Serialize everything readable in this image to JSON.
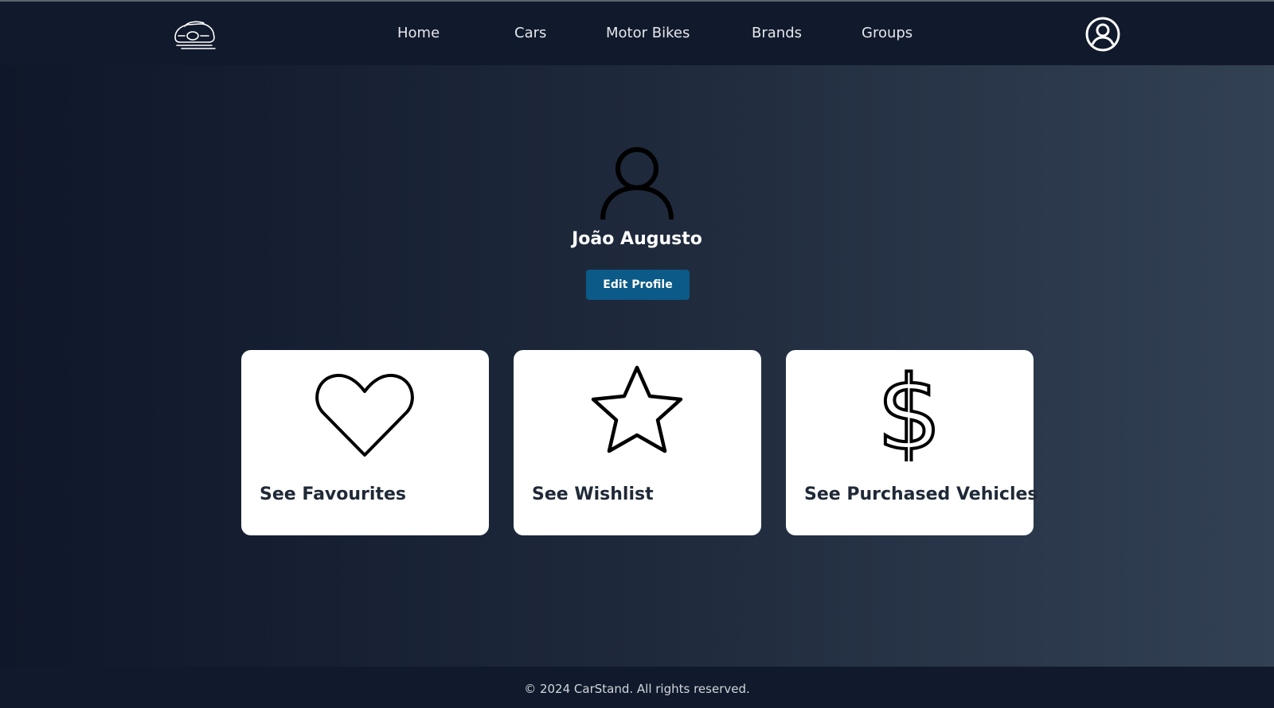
{
  "nav": {
    "logo_icon": "car-logo-icon",
    "links": [
      {
        "label": "Home"
      },
      {
        "label": "Cars"
      },
      {
        "label": "Motor Bikes"
      },
      {
        "label": "Brands"
      },
      {
        "label": "Groups"
      }
    ],
    "account_icon": "user-circle-icon"
  },
  "profile": {
    "icon": "user-icon",
    "name": "João Augusto",
    "edit_label": "Edit Profile"
  },
  "cards": [
    {
      "label": "See Favourites",
      "icon": "heart-icon"
    },
    {
      "label": "See Wishlist",
      "icon": "star-icon"
    },
    {
      "label": "See Purchased Vehicles",
      "icon": "dollar-icon"
    }
  ],
  "footer": {
    "text": "© 2024 CarStand. All rights reserved."
  },
  "colors": {
    "nav_background": "#111a2c",
    "button_primary": "#0b5a87",
    "card_background": "#ffffff",
    "gradient_start": "#0f172a",
    "gradient_end": "#334155"
  }
}
